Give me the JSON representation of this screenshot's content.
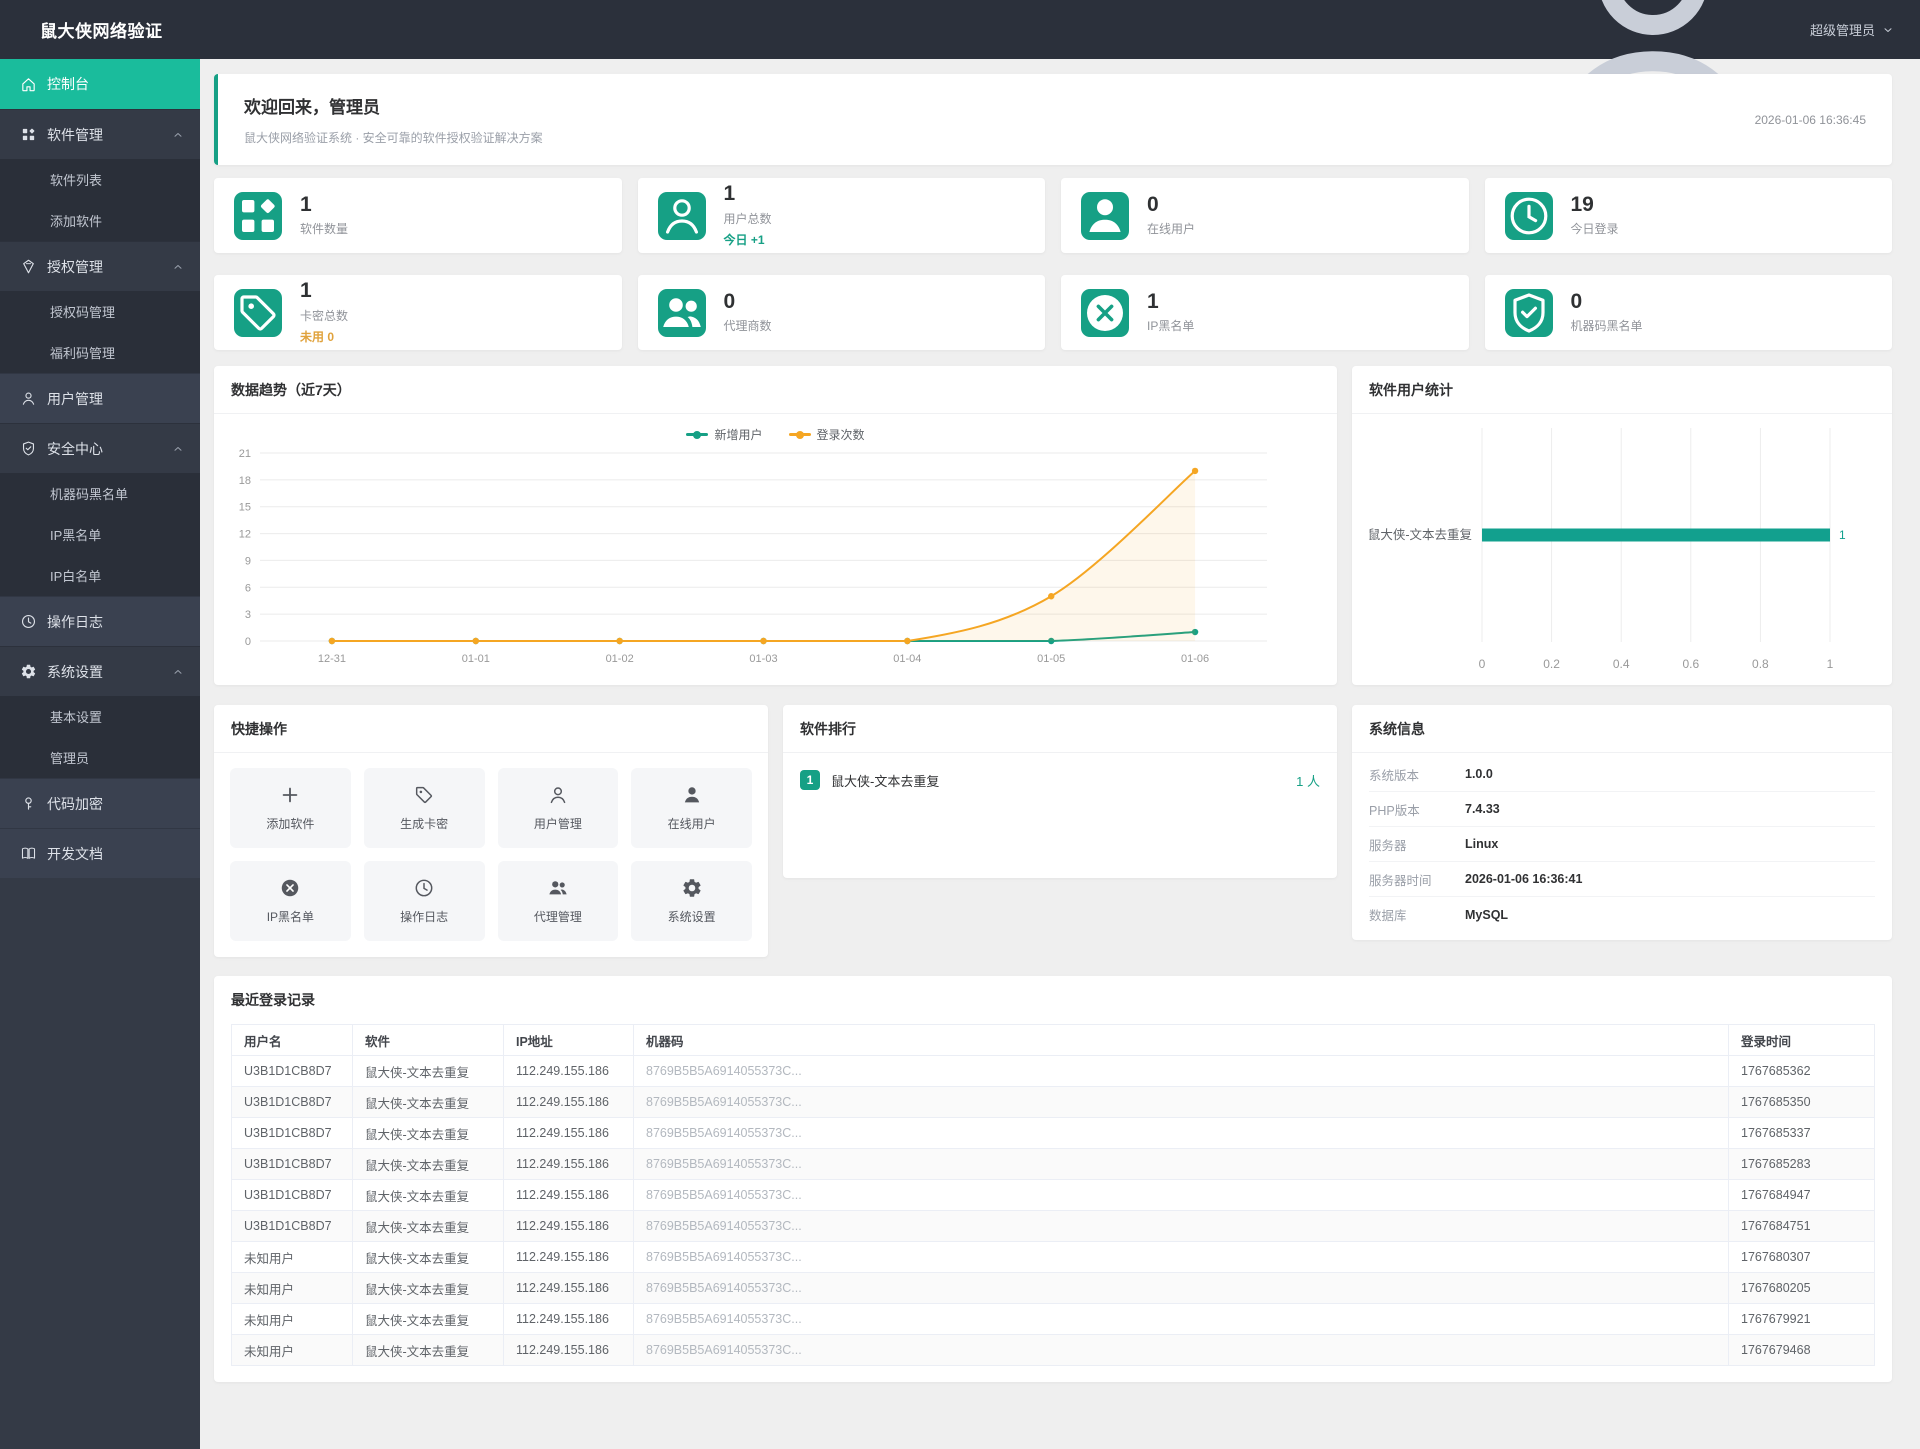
{
  "colors": {
    "accent": "#16a085",
    "sidebar_active": "#1abc9c",
    "chart_teal": "#16a085",
    "chart_orange": "#f5a623",
    "warning_orange": "#e0a23c"
  },
  "header": {
    "title": "鼠大侠网络验证",
    "user": "超级管理员"
  },
  "sidebar": {
    "items": [
      {
        "slug": "console",
        "icon": "home",
        "label": "控制台",
        "active": true
      },
      {
        "slug": "software-management",
        "icon": "apps",
        "label": "软件管理",
        "expanded": true,
        "children": [
          {
            "slug": "software-list",
            "label": "软件列表"
          },
          {
            "slug": "add-software",
            "label": "添加软件"
          }
        ]
      },
      {
        "slug": "license-management",
        "icon": "badge",
        "label": "授权管理",
        "expanded": true,
        "children": [
          {
            "slug": "license-code-management",
            "label": "授权码管理"
          },
          {
            "slug": "welfare-code-management",
            "label": "福利码管理"
          }
        ]
      },
      {
        "slug": "user-management",
        "icon": "user",
        "label": "用户管理"
      },
      {
        "slug": "security-center",
        "icon": "shield-check",
        "label": "安全中心",
        "expanded": true,
        "children": [
          {
            "slug": "machine-code-blacklist",
            "label": "机器码黑名单"
          },
          {
            "slug": "ip-blacklist",
            "label": "IP黑名单"
          },
          {
            "slug": "ip-whitelist",
            "label": "IP白名单"
          }
        ]
      },
      {
        "slug": "operation-log",
        "icon": "clock",
        "label": "操作日志"
      },
      {
        "slug": "system-settings",
        "icon": "gear",
        "label": "系统设置",
        "expanded": true,
        "children": [
          {
            "slug": "basic-settings",
            "label": "基本设置"
          },
          {
            "slug": "administrator",
            "label": "管理员"
          }
        ]
      },
      {
        "slug": "code-encryption",
        "icon": "key",
        "label": "代码加密"
      },
      {
        "slug": "dev-docs",
        "icon": "book",
        "label": "开发文档"
      }
    ]
  },
  "welcome": {
    "title": "欢迎回来，管理员",
    "subtitle": "鼠大侠网络验证系统 · 安全可靠的软件授权验证解决方案",
    "timestamp": "2026-01-06 16:36:45"
  },
  "stats": [
    {
      "slug": "software-count",
      "icon": "apps",
      "value": "1",
      "label": "软件数量"
    },
    {
      "slug": "user-total",
      "icon": "user",
      "value": "1",
      "label": "用户总数",
      "extra": "今日 +1",
      "extra_style": "teal"
    },
    {
      "slug": "online-users",
      "icon": "user-solid",
      "value": "0",
      "label": "在线用户"
    },
    {
      "slug": "today-logins",
      "icon": "clock",
      "value": "19",
      "label": "今日登录"
    },
    {
      "slug": "card-total",
      "icon": "tag",
      "value": "1",
      "label": "卡密总数",
      "extra": "未用 0",
      "extra_style": "orange"
    },
    {
      "slug": "agent-count",
      "icon": "users",
      "value": "0",
      "label": "代理商数"
    },
    {
      "slug": "ip-blacklist-count",
      "icon": "block",
      "value": "1",
      "label": "IP黑名单"
    },
    {
      "slug": "machine-code-blacklist-count",
      "icon": "shield-check",
      "value": "0",
      "label": "机器码黑名单"
    }
  ],
  "chart_data": [
    {
      "type": "line",
      "title": "数据趋势（近7天）",
      "x": [
        "12-31",
        "01-01",
        "01-02",
        "01-03",
        "01-04",
        "01-05",
        "01-06"
      ],
      "series": [
        {
          "name": "新增用户",
          "color": "#16a085",
          "values": [
            0,
            0,
            0,
            0,
            0,
            0,
            1
          ],
          "area": false
        },
        {
          "name": "登录次数",
          "color": "#f5a623",
          "values": [
            0,
            0,
            0,
            0,
            0,
            5,
            19
          ],
          "area": true
        }
      ],
      "ylim": [
        0,
        21
      ],
      "yticks": [
        0,
        3,
        6,
        9,
        12,
        15,
        18,
        21
      ],
      "grid": true,
      "legend_position": "top-center"
    },
    {
      "type": "bar",
      "orientation": "horizontal",
      "title": "软件用户统计",
      "categories": [
        "鼠大侠-文本去重复"
      ],
      "values": [
        1
      ],
      "value_labels": [
        "1"
      ],
      "xlim": [
        0,
        1
      ],
      "xticks": [
        0,
        0.2,
        0.4,
        0.6,
        0.8,
        1
      ],
      "color": "#12a08e",
      "grid": true
    }
  ],
  "quick_actions": {
    "title": "快捷操作",
    "items": [
      {
        "slug": "add-software",
        "icon": "plus",
        "label": "添加软件"
      },
      {
        "slug": "generate-card",
        "icon": "tag",
        "label": "生成卡密"
      },
      {
        "slug": "user-management",
        "icon": "user",
        "label": "用户管理"
      },
      {
        "slug": "online-users",
        "icon": "user-solid",
        "label": "在线用户"
      },
      {
        "slug": "ip-blacklist",
        "icon": "block",
        "label": "IP黑名单"
      },
      {
        "slug": "operation-log",
        "icon": "clock",
        "label": "操作日志"
      },
      {
        "slug": "agent-management",
        "icon": "users",
        "label": "代理管理"
      },
      {
        "slug": "system-settings",
        "icon": "gear",
        "label": "系统设置"
      }
    ]
  },
  "ranking": {
    "title": "软件排行",
    "items": [
      {
        "rank": "1",
        "name": "鼠大侠-文本去重复",
        "count": "1 人"
      }
    ]
  },
  "system_info": {
    "title": "系统信息",
    "rows": [
      {
        "label": "系统版本",
        "value": "1.0.0"
      },
      {
        "label": "PHP版本",
        "value": "7.4.33"
      },
      {
        "label": "服务器",
        "value": "Linux"
      },
      {
        "label": "服务器时间",
        "value": "2026-01-06 16:36:41"
      },
      {
        "label": "数据库",
        "value": "MySQL"
      }
    ]
  },
  "login_table": {
    "title": "最近登录记录",
    "columns": [
      "用户名",
      "软件",
      "IP地址",
      "机器码",
      "登录时间"
    ],
    "rows": [
      [
        "U3B1D1CB8D7",
        "鼠大侠-文本去重复",
        "112.249.155.186",
        "8769B5B5A6914055373C...",
        "1767685362"
      ],
      [
        "U3B1D1CB8D7",
        "鼠大侠-文本去重复",
        "112.249.155.186",
        "8769B5B5A6914055373C...",
        "1767685350"
      ],
      [
        "U3B1D1CB8D7",
        "鼠大侠-文本去重复",
        "112.249.155.186",
        "8769B5B5A6914055373C...",
        "1767685337"
      ],
      [
        "U3B1D1CB8D7",
        "鼠大侠-文本去重复",
        "112.249.155.186",
        "8769B5B5A6914055373C...",
        "1767685283"
      ],
      [
        "U3B1D1CB8D7",
        "鼠大侠-文本去重复",
        "112.249.155.186",
        "8769B5B5A6914055373C...",
        "1767684947"
      ],
      [
        "U3B1D1CB8D7",
        "鼠大侠-文本去重复",
        "112.249.155.186",
        "8769B5B5A6914055373C...",
        "1767684751"
      ],
      [
        "未知用户",
        "鼠大侠-文本去重复",
        "112.249.155.186",
        "8769B5B5A6914055373C...",
        "1767680307"
      ],
      [
        "未知用户",
        "鼠大侠-文本去重复",
        "112.249.155.186",
        "8769B5B5A6914055373C...",
        "1767680205"
      ],
      [
        "未知用户",
        "鼠大侠-文本去重复",
        "112.249.155.186",
        "8769B5B5A6914055373C...",
        "1767679921"
      ],
      [
        "未知用户",
        "鼠大侠-文本去重复",
        "112.249.155.186",
        "8769B5B5A6914055373C...",
        "1767679468"
      ]
    ]
  }
}
